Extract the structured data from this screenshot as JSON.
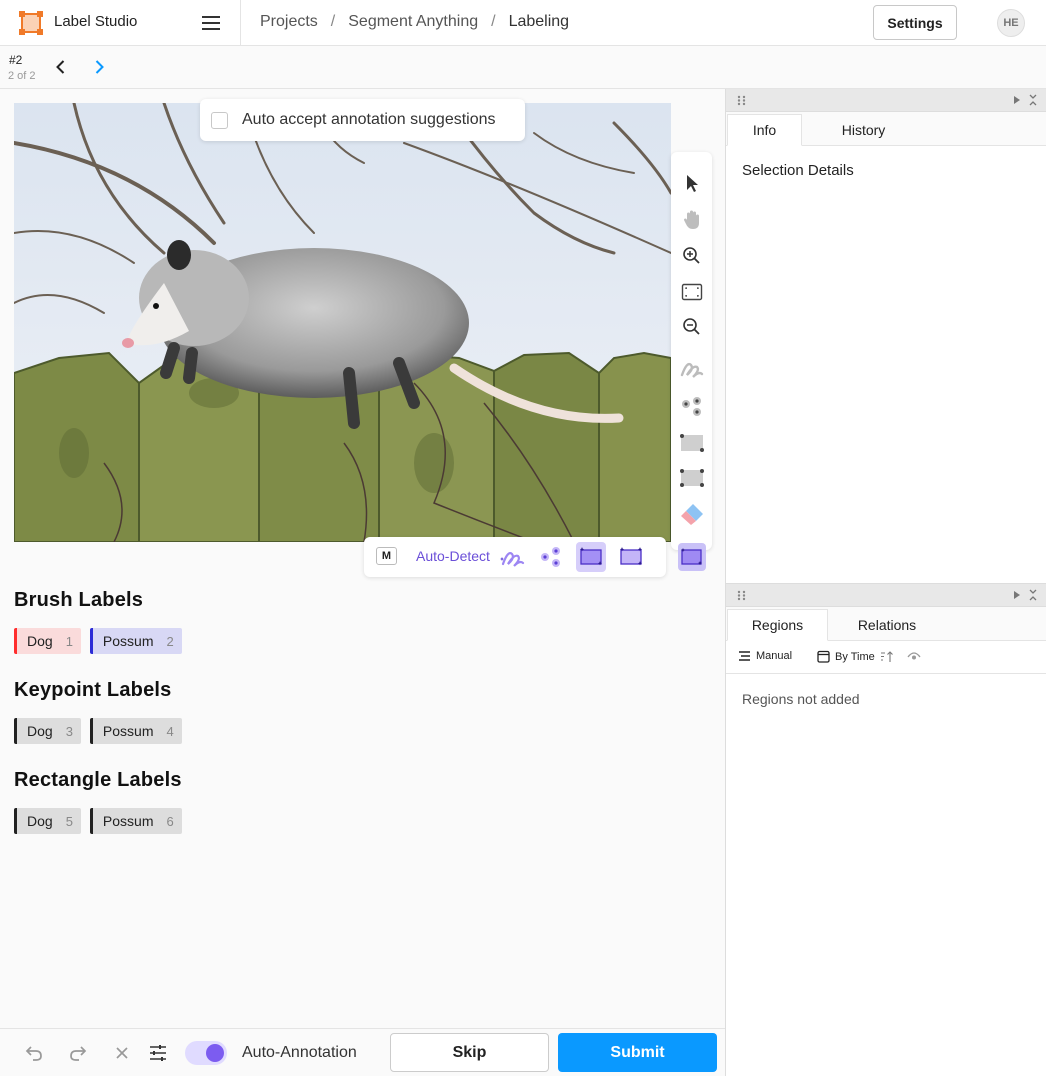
{
  "app": {
    "name": "Label Studio"
  },
  "breadcrumb": {
    "items": [
      "Projects",
      "Segment Anything",
      "Labeling"
    ],
    "sep": "/"
  },
  "header": {
    "settings_label": "Settings",
    "avatar_initials": "HE"
  },
  "task": {
    "id": "#2",
    "count": "2 of 2"
  },
  "canvas": {
    "auto_accept_label": "Auto accept annotation suggestions",
    "auto_accept_checked": false,
    "image_alt": "opossum on a wooden fence"
  },
  "smart_toolbar": {
    "hotkey": "M",
    "label": "Auto-Detect"
  },
  "label_groups": [
    {
      "title": "Brush Labels",
      "labels": [
        {
          "name": "Dog",
          "hotkey": "1",
          "color": "#ff2d2d",
          "bg": "#fadbdb"
        },
        {
          "name": "Possum",
          "hotkey": "2",
          "color": "#2b2bd6",
          "bg": "#d8d8f5"
        }
      ]
    },
    {
      "title": "Keypoint Labels",
      "labels": [
        {
          "name": "Dog",
          "hotkey": "3",
          "color": "#222222",
          "bg": "#dddddd"
        },
        {
          "name": "Possum",
          "hotkey": "4",
          "color": "#222222",
          "bg": "#dddddd"
        }
      ]
    },
    {
      "title": "Rectangle Labels",
      "labels": [
        {
          "name": "Dog",
          "hotkey": "5",
          "color": "#222222",
          "bg": "#dddddd"
        },
        {
          "name": "Possum",
          "hotkey": "6",
          "color": "#222222",
          "bg": "#dddddd"
        }
      ]
    }
  ],
  "bottom_bar": {
    "auto_annotation_label": "Auto-Annotation",
    "auto_annotation_enabled": true,
    "skip_label": "Skip",
    "submit_label": "Submit"
  },
  "info_panel": {
    "tabs": [
      "Info",
      "History"
    ],
    "active_tab": "Info",
    "selection_title": "Selection Details"
  },
  "regions_panel": {
    "tabs": [
      "Regions",
      "Relations"
    ],
    "active_tab": "Regions",
    "group_label": "Manual",
    "sort_label": "By Time",
    "empty_text": "Regions not added"
  },
  "colors": {
    "accent": "#0a99ff",
    "purple": "#7c5cf0",
    "logo": "#f07a29"
  }
}
